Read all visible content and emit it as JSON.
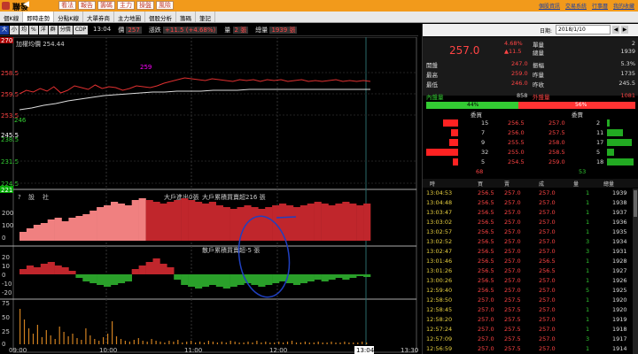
{
  "topbar": {
    "stock_name": "聯發",
    "back": "◀",
    "buttons": [
      "看法",
      "報告",
      "籌碼",
      "主力",
      "操盤",
      "風險"
    ],
    "links": [
      "個股資訊",
      "交易系統",
      "行事曆",
      "我的收藏"
    ]
  },
  "tabs": [
    "個K線",
    "即時走勢",
    "分點K線",
    "大單券商",
    "主力地圖",
    "個股分析",
    "籌碼",
    "筆記"
  ],
  "chart_toolbar": {
    "buttons": [
      "大",
      "小",
      "均",
      "%",
      "洋",
      "群",
      "分價",
      "CDP"
    ],
    "time": "13:04",
    "price_label": "價",
    "price_value": "257",
    "change_label": "漲跌",
    "change_value": "+11.5 (+4.68%)",
    "vol_label": "量",
    "vol_value": "2 張",
    "total_label": "總量",
    "total_value": "1939 張"
  },
  "chart": {
    "legend_ma": "加權均價 254.44",
    "high_marker": "259",
    "price_ticks": [
      "270",
      "258.5",
      "259.5",
      "253.5",
      "245.5",
      "238.5",
      "231.5",
      "224.5",
      "221"
    ],
    "low_label": "246",
    "panel2_labels": [
      "?",
      "設",
      "社"
    ],
    "panel2_title": "大戶進出0張",
    "panel2_sub": "大戶累積買賣超216 張",
    "panel2_ticks": [
      "200",
      "100",
      "0"
    ],
    "panel3_title": "散戶累積買賣超-5 張",
    "panel3_ticks": [
      "20",
      "10",
      "0",
      "-10",
      "-20"
    ],
    "panel4_ticks": [
      "75",
      "50",
      "25",
      "0"
    ],
    "time_labels": [
      "09:00",
      "10:00",
      "11:00",
      "12:00",
      "13:04",
      "13:30"
    ],
    "colors": {
      "price_line": "#e03030",
      "avg_line": "#dddddd",
      "big_buy": "#c0262c",
      "big_buy_light": "#f08080",
      "retail_up": "#c0262c",
      "retail_down": "#2aa02a",
      "volume": "#d08020"
    }
  },
  "right": {
    "date_label": "日期:",
    "date_value": "2018/1/10",
    "quote": {
      "big_price": "257.0",
      "pct": "4.68%",
      "chg": "▲11.5",
      "buy_label": "單量",
      "buy_value": "2",
      "total_label": "總量",
      "total_value": "1939",
      "open_label": "開盤",
      "open_value": "247.0",
      "amp_label": "振幅",
      "amp_value": "5.3%",
      "high_label": "最高",
      "high_value": "259.0",
      "prev_vol_label": "昨量",
      "prev_vol_value": "1735",
      "low_label": "最低",
      "low_value": "246.0",
      "prev_close_label": "昨收",
      "prev_close_value": "245.5"
    },
    "balance": {
      "in_label": "內盤量",
      "in_value": "858",
      "out_label": "外盤量",
      "out_value": "1081",
      "in_pct": "44%",
      "out_pct": "56%",
      "in_ratio": 0.44
    },
    "depth_head": {
      "bid": "委買",
      "ask": "委賣"
    },
    "depth": [
      {
        "bid_vol": "15",
        "bid": "256.5",
        "ask": "257.0",
        "ask_vol": "2"
      },
      {
        "bid_vol": "7",
        "bid": "256.0",
        "ask": "257.5",
        "ask_vol": "11"
      },
      {
        "bid_vol": "9",
        "bid": "255.5",
        "ask": "258.0",
        "ask_vol": "17"
      },
      {
        "bid_vol": "32",
        "bid": "255.0",
        "ask": "258.5",
        "ask_vol": "5"
      },
      {
        "bid_vol": "5",
        "bid": "254.5",
        "ask": "259.0",
        "ask_vol": "18"
      }
    ],
    "depth_totals": {
      "bid": "68",
      "ask": "53"
    },
    "ticks_head": [
      "時",
      "買",
      "賣",
      "成",
      "量",
      "總量"
    ],
    "ticks": [
      {
        "time": "13:04:53",
        "bid": "256.5",
        "ask": "257.0",
        "deal": "257.0",
        "vol": "1",
        "total": "1939"
      },
      {
        "time": "13:04:48",
        "bid": "256.5",
        "ask": "257.0",
        "deal": "257.0",
        "vol": "1",
        "total": "1938"
      },
      {
        "time": "13:03:47",
        "bid": "256.5",
        "ask": "257.0",
        "deal": "257.0",
        "vol": "1",
        "total": "1937"
      },
      {
        "time": "13:03:02",
        "bid": "256.5",
        "ask": "257.0",
        "deal": "257.0",
        "vol": "1",
        "total": "1936"
      },
      {
        "time": "13:02:57",
        "bid": "256.5",
        "ask": "257.0",
        "deal": "257.0",
        "vol": "1",
        "total": "1935"
      },
      {
        "time": "13:02:52",
        "bid": "256.5",
        "ask": "257.0",
        "deal": "257.0",
        "vol": "3",
        "total": "1934"
      },
      {
        "time": "13:02:47",
        "bid": "256.5",
        "ask": "257.0",
        "deal": "257.0",
        "vol": "3",
        "total": "1931"
      },
      {
        "time": "13:01:46",
        "bid": "256.5",
        "ask": "257.0",
        "deal": "256.5",
        "vol": "1",
        "total": "1928"
      },
      {
        "time": "13:01:26",
        "bid": "256.5",
        "ask": "257.0",
        "deal": "256.5",
        "vol": "1",
        "total": "1927"
      },
      {
        "time": "13:00:26",
        "bid": "256.5",
        "ask": "257.0",
        "deal": "257.0",
        "vol": "1",
        "total": "1926"
      },
      {
        "time": "12:59:40",
        "bid": "256.5",
        "ask": "257.0",
        "deal": "257.0",
        "vol": "5",
        "total": "1925"
      },
      {
        "time": "12:58:50",
        "bid": "257.0",
        "ask": "257.5",
        "deal": "257.0",
        "vol": "1",
        "total": "1920"
      },
      {
        "time": "12:58:45",
        "bid": "257.0",
        "ask": "257.5",
        "deal": "257.0",
        "vol": "1",
        "total": "1920"
      },
      {
        "time": "12:58:20",
        "bid": "257.0",
        "ask": "257.5",
        "deal": "257.0",
        "vol": "1",
        "total": "1919"
      },
      {
        "time": "12:57:24",
        "bid": "257.0",
        "ask": "257.5",
        "deal": "257.0",
        "vol": "1",
        "total": "1918"
      },
      {
        "time": "12:57:09",
        "bid": "257.0",
        "ask": "257.5",
        "deal": "257.0",
        "vol": "3",
        "total": "1917"
      },
      {
        "time": "12:56:59",
        "bid": "257.0",
        "ask": "257.5",
        "deal": "257.0",
        "vol": "1",
        "total": "1914"
      }
    ]
  }
}
